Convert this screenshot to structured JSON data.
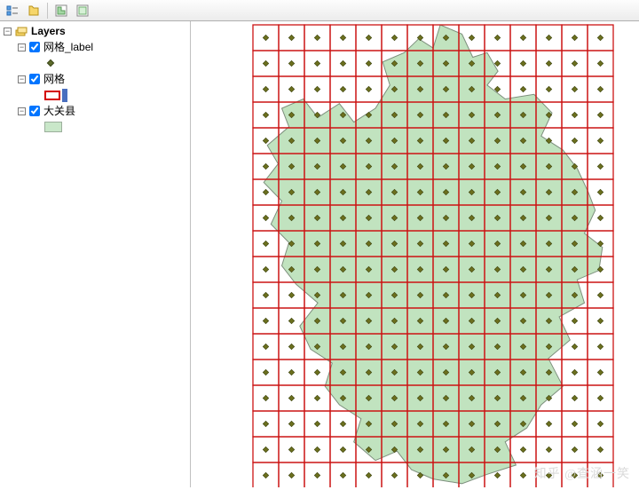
{
  "toolbar": {
    "icons": [
      "list-by-drawing",
      "list-by-source",
      "list-by-visibility",
      "list-by-selection",
      "options"
    ]
  },
  "toc": {
    "root_label": "Layers",
    "layers": [
      {
        "name": "网格_label",
        "symbol": "point",
        "checked": true
      },
      {
        "name": "网格",
        "symbol": "grid",
        "checked": true
      },
      {
        "name": "大关县",
        "symbol": "polygon",
        "checked": true
      }
    ]
  },
  "map": {
    "grid": {
      "cols": 14,
      "rows": 18
    },
    "polygon_fill": "#c1e3bf",
    "polygon_stroke": "#7d8f7d",
    "grid_stroke": "#cc1414",
    "point_fill": "#6b6f1e"
  },
  "watermark": "知乎 @查涵一笑"
}
